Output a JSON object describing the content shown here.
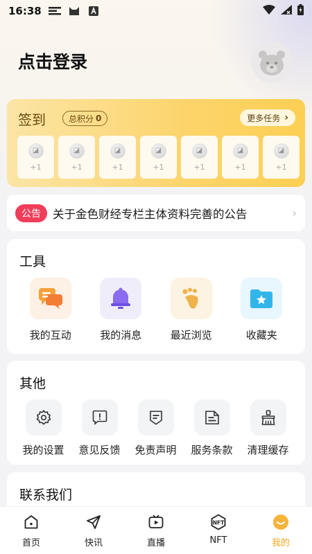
{
  "status_bar": {
    "time": "16:38"
  },
  "profile": {
    "login_title": "点击登录"
  },
  "signin": {
    "title": "签到",
    "points_label": "总积分",
    "points_value": "0",
    "more_tasks": "更多任务",
    "days": [
      {
        "reward": "+1"
      },
      {
        "reward": "+1"
      },
      {
        "reward": "+1"
      },
      {
        "reward": "+1"
      },
      {
        "reward": "+1"
      },
      {
        "reward": "+1"
      },
      {
        "reward": "+1"
      }
    ]
  },
  "notice": {
    "tag": "公告",
    "text": "关于金色财经专栏主体资料完善的公告"
  },
  "tools": {
    "title": "工具",
    "items": [
      {
        "label": "我的互动",
        "icon": "chat-icon",
        "bg": "#fdf0e4",
        "color": "#f5a23a"
      },
      {
        "label": "我的消息",
        "icon": "bell-icon",
        "bg": "#f0edfb",
        "color": "#8a6cf0"
      },
      {
        "label": "最近浏览",
        "icon": "footprint-icon",
        "bg": "#fdf3e2",
        "color": "#f0b24a"
      },
      {
        "label": "收藏夹",
        "icon": "folder-star-icon",
        "bg": "#e8f6fd",
        "color": "#32b6ea"
      }
    ]
  },
  "other": {
    "title": "其他",
    "items": [
      {
        "label": "我的设置",
        "icon": "gear-icon"
      },
      {
        "label": "意见反馈",
        "icon": "feedback-icon"
      },
      {
        "label": "免责声明",
        "icon": "disclaimer-icon"
      },
      {
        "label": "服务条款",
        "icon": "terms-icon"
      },
      {
        "label": "清理缓存",
        "icon": "broom-icon"
      }
    ]
  },
  "contact": {
    "title": "联系我们"
  },
  "tabbar": {
    "active_color": "#f2a71a",
    "items": [
      {
        "label": "首页",
        "icon": "home-icon"
      },
      {
        "label": "快讯",
        "icon": "send-icon"
      },
      {
        "label": "直播",
        "icon": "live-icon"
      },
      {
        "label": "NFT",
        "icon": "nft-icon"
      },
      {
        "label": "我的",
        "icon": "me-icon"
      }
    ]
  }
}
